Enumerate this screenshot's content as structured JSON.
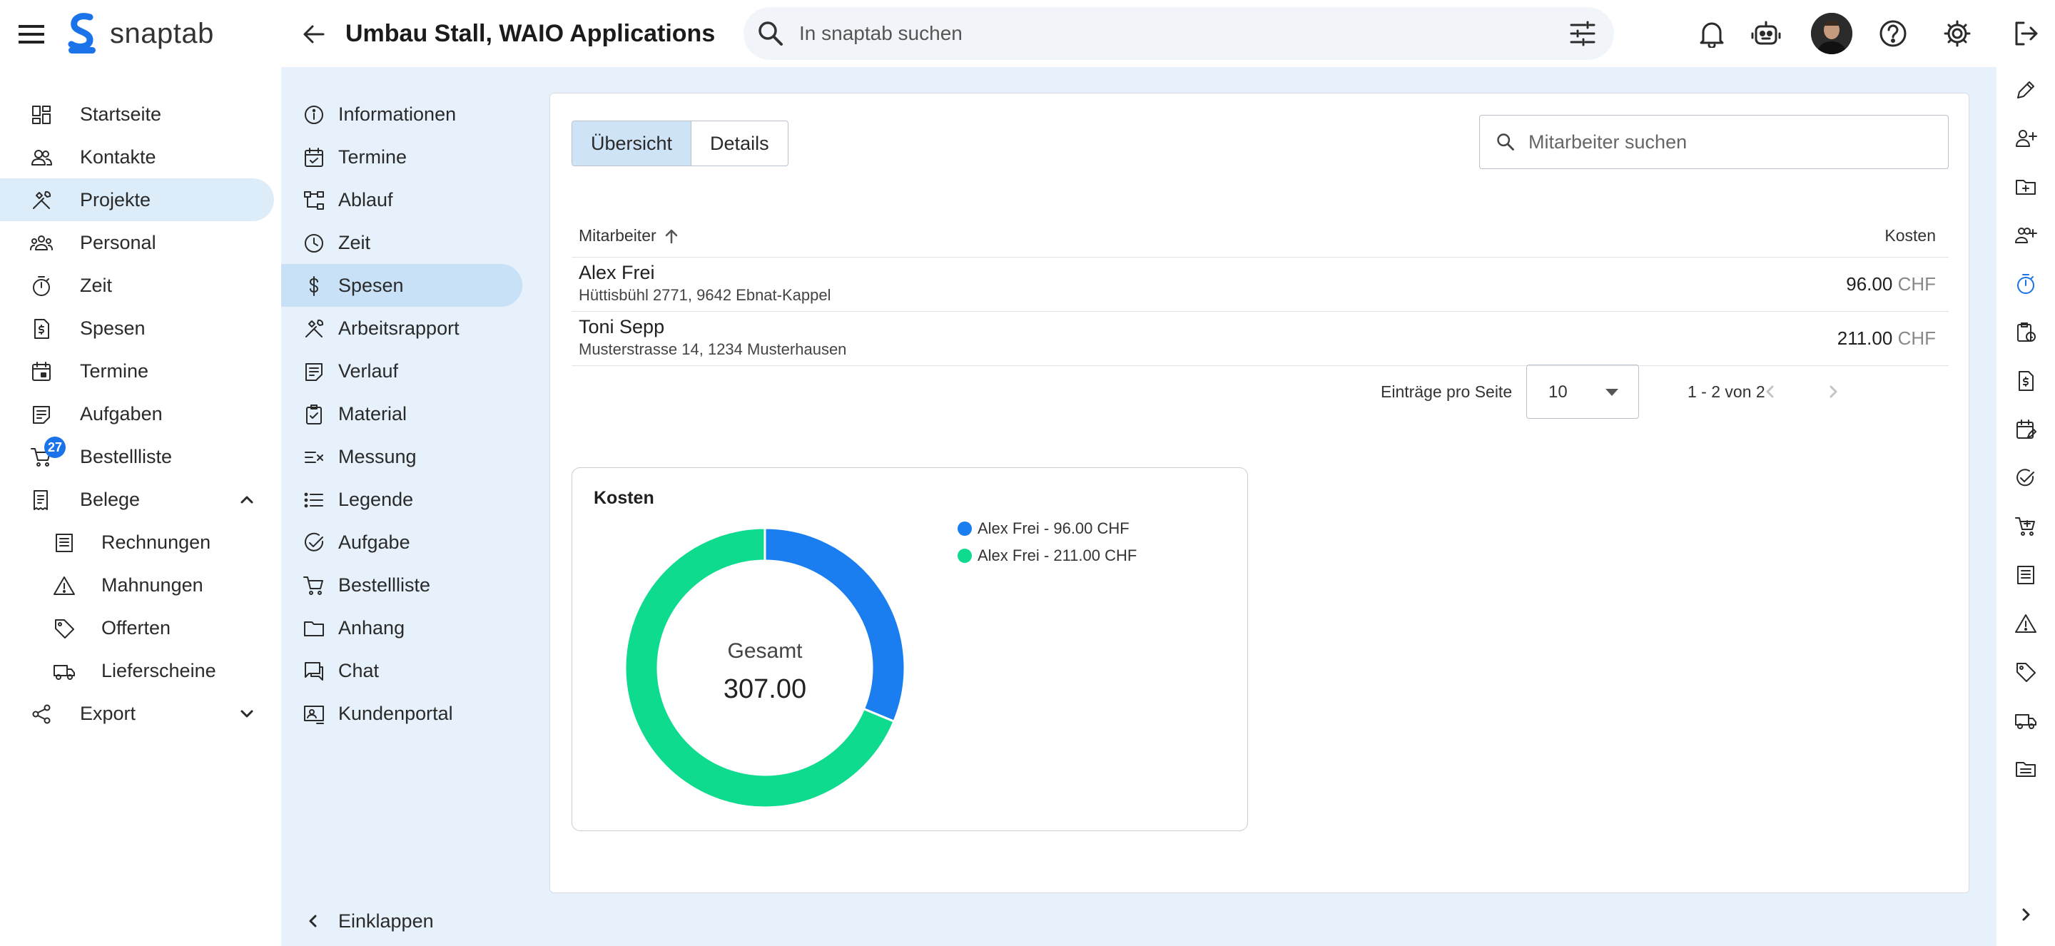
{
  "app": {
    "name": "snaptab"
  },
  "header": {
    "project_title": "Umbau Stall, WAIO Applications",
    "search_placeholder": "In snaptab suchen"
  },
  "leftnav": {
    "items": [
      {
        "id": "startseite",
        "label": "Startseite",
        "icon": "dashboard-icon"
      },
      {
        "id": "kontakte",
        "label": "Kontakte",
        "icon": "contacts-icon"
      },
      {
        "id": "projekte",
        "label": "Projekte",
        "icon": "tools-icon",
        "active": true
      },
      {
        "id": "personal",
        "label": "Personal",
        "icon": "group-icon"
      },
      {
        "id": "zeit",
        "label": "Zeit",
        "icon": "timer-icon"
      },
      {
        "id": "spesen",
        "label": "Spesen",
        "icon": "expense-icon"
      },
      {
        "id": "termine",
        "label": "Termine",
        "icon": "calendar-icon"
      },
      {
        "id": "aufgaben",
        "label": "Aufgaben",
        "icon": "task-icon"
      },
      {
        "id": "bestellliste",
        "label": "Bestellliste",
        "icon": "cart-icon",
        "badge": "27"
      },
      {
        "id": "belege",
        "label": "Belege",
        "icon": "receipt-icon",
        "expanded": true
      },
      {
        "id": "rechnungen",
        "label": "Rechnungen",
        "icon": "invoice-icon",
        "sub": true
      },
      {
        "id": "mahnungen",
        "label": "Mahnungen",
        "icon": "warning-icon",
        "sub": true
      },
      {
        "id": "offerten",
        "label": "Offerten",
        "icon": "tag-icon",
        "sub": true
      },
      {
        "id": "lieferscheine",
        "label": "Lieferscheine",
        "icon": "truck-icon",
        "sub": true
      },
      {
        "id": "export",
        "label": "Export",
        "icon": "share-icon",
        "collapsed": true
      }
    ]
  },
  "projnav": {
    "items": [
      {
        "id": "informationen",
        "label": "Informationen",
        "icon": "info-icon"
      },
      {
        "id": "termine",
        "label": "Termine",
        "icon": "calendar-check-icon"
      },
      {
        "id": "ablauf",
        "label": "Ablauf",
        "icon": "flow-icon"
      },
      {
        "id": "zeit",
        "label": "Zeit",
        "icon": "clock-icon"
      },
      {
        "id": "spesen",
        "label": "Spesen",
        "icon": "dollar-icon",
        "active": true
      },
      {
        "id": "arbeitsrapport",
        "label": "Arbeitsrapport",
        "icon": "tools-icon"
      },
      {
        "id": "verlauf",
        "label": "Verlauf",
        "icon": "history-icon"
      },
      {
        "id": "material",
        "label": "Material",
        "icon": "clipboard-icon"
      },
      {
        "id": "messung",
        "label": "Messung",
        "icon": "measure-icon"
      },
      {
        "id": "legende",
        "label": "Legende",
        "icon": "list-icon"
      },
      {
        "id": "aufgabe",
        "label": "Aufgabe",
        "icon": "check-circle-icon"
      },
      {
        "id": "bestellliste",
        "label": "Bestellliste",
        "icon": "cart-icon"
      },
      {
        "id": "anhang",
        "label": "Anhang",
        "icon": "folder-icon"
      },
      {
        "id": "chat",
        "label": "Chat",
        "icon": "chat-icon"
      },
      {
        "id": "kundenportal",
        "label": "Kundenportal",
        "icon": "portal-icon"
      }
    ],
    "collapse_label": "Einklappen"
  },
  "main": {
    "tabs": [
      {
        "label": "Übersicht",
        "active": true
      },
      {
        "label": "Details",
        "active": false
      }
    ],
    "employee_search_placeholder": "Mitarbeiter suchen",
    "table": {
      "columns": {
        "employee": "Mitarbeiter",
        "cost": "Kosten"
      },
      "rows": [
        {
          "name": "Alex Frei",
          "address": "Hüttisbühl 2771, 9642 Ebnat-Kappel",
          "amount": "96.00",
          "currency": "CHF"
        },
        {
          "name": "Toni Sepp",
          "address": "Musterstrasse 14, 1234 Musterhausen",
          "amount": "211.00",
          "currency": "CHF"
        }
      ]
    },
    "paginator": {
      "per_page_label": "Einträge pro Seite",
      "per_page_value": "10",
      "range_label": "1 - 2 von 2"
    },
    "chart_card": {
      "title": "Kosten",
      "center_label": "Gesamt",
      "center_value": "307.00"
    }
  },
  "chart_data": {
    "type": "pie",
    "donut": true,
    "title": "Kosten",
    "categories": [
      "Alex Frei - 96.00 CHF",
      "Alex Frei - 211.00 CHF"
    ],
    "values": [
      96,
      211
    ],
    "colors": [
      "#1a7ef0",
      "#0fdb8f"
    ],
    "legend": "right",
    "total": 307
  },
  "colors": {
    "accent": "#1a73e8",
    "nav_active": "#dcecf9",
    "panel_bg": "#e6f1fb"
  }
}
